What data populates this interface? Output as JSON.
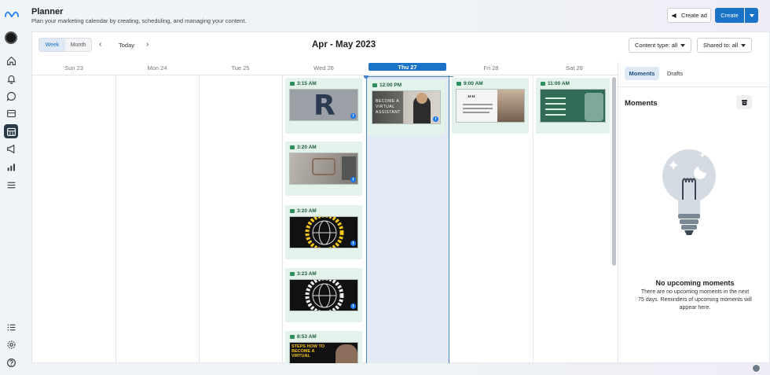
{
  "header": {
    "title": "Planner",
    "subtitle": "Plan your marketing calendar by creating, scheduling, and managing your content.",
    "create_ad_label": "Create ad",
    "create_label": "Create"
  },
  "toolbar": {
    "view_week": "Week",
    "view_month": "Month",
    "selected_view": "Week",
    "today_label": "Today",
    "date_range": "Apr - May 2023",
    "content_type_label": "Content type: all",
    "shared_to_label": "Shared to: all"
  },
  "days": [
    {
      "label": "Sun 23",
      "today": false
    },
    {
      "label": "Mon 24",
      "today": false
    },
    {
      "label": "Tue 25",
      "today": false
    },
    {
      "label": "Wed 26",
      "today": false
    },
    {
      "label": "Thu 27",
      "today": true
    },
    {
      "label": "Fri 28",
      "today": false
    },
    {
      "label": "Sat 29",
      "today": false
    }
  ],
  "posts": {
    "wed_1": {
      "time": "3:15 AM",
      "image": "Letter R logo graphic"
    },
    "wed_2": {
      "time": "3:20 AM",
      "image": "Desk flat-lay with logo"
    },
    "wed_3": {
      "time": "3:20 AM",
      "image": "Globe logo with circular text"
    },
    "wed_4": {
      "time": "3:23 AM",
      "image": "Globe logo with circular text"
    },
    "wed_5": {
      "time": "8:53 AM",
      "image": "STEPS HOW TO BECOME A VIRTUAL promo",
      "overlay": "STEPS HOW TO BECOME A VIRTUAL"
    },
    "thu_1": {
      "time": "12:00 PM",
      "image": "Become a Virtual Assistant promo",
      "overlay": "BECOME A VIRTUAL ASSISTANT"
    },
    "fri_1": {
      "time": "9:00 AM",
      "image": "Quote graphic with woman"
    },
    "sat_1": {
      "time": "11:00 AM",
      "image": "Green checklist graphic"
    }
  },
  "sidebar": {
    "tab_moments": "Moments",
    "tab_drafts": "Drafts",
    "active_tab": "Moments",
    "title": "Moments",
    "empty_title": "No upcoming moments",
    "empty_text": "There are no upcoming moments in the next 75 days. Reminders of upcoming moments will appear here."
  },
  "colors": {
    "accent": "#1a73c7",
    "card_bg": "#e3f2ea",
    "today_col": "#e2ebf5",
    "facebook": "#1877f2"
  },
  "icons": [
    "meta-logo",
    "home-icon",
    "notification-icon",
    "chat-icon",
    "posts-icon",
    "planner-icon",
    "ads-icon",
    "insights-icon",
    "menu-icon",
    "list-icon",
    "settings-icon",
    "help-icon",
    "globe-icon",
    "lightbulb-illustration"
  ]
}
